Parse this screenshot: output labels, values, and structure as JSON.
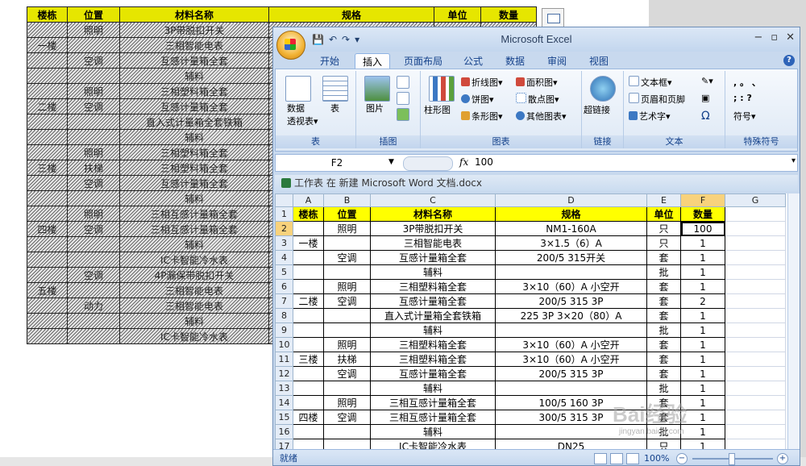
{
  "word_table": {
    "header": [
      "楼栋",
      "位置",
      "材料名称",
      "规格",
      "单位",
      "数量"
    ],
    "rows": [
      [
        "",
        "照明",
        "3P带脱扣开关",
        "",
        "",
        ""
      ],
      [
        "一楼",
        "",
        "三相智能电表",
        "",
        "",
        ""
      ],
      [
        "",
        "空调",
        "互感计量箱全套",
        "",
        "",
        ""
      ],
      [
        "",
        "",
        "辅料",
        "",
        "",
        ""
      ],
      [
        "",
        "照明",
        "三相塑料箱全套",
        "",
        "",
        ""
      ],
      [
        "二楼",
        "空调",
        "互感计量箱全套",
        "",
        "",
        ""
      ],
      [
        "",
        "",
        "直入式计量箱全套铁箱",
        "",
        "",
        ""
      ],
      [
        "",
        "",
        "辅料",
        "",
        "",
        ""
      ],
      [
        "",
        "照明",
        "三相塑料箱全套",
        "",
        "",
        ""
      ],
      [
        "三楼",
        "扶梯",
        "三相塑料箱全套",
        "",
        "",
        ""
      ],
      [
        "",
        "空调",
        "互感计量箱全套",
        "",
        "",
        ""
      ],
      [
        "",
        "",
        "辅料",
        "",
        "",
        ""
      ],
      [
        "",
        "照明",
        "三相互感计量箱全套",
        "",
        "",
        ""
      ],
      [
        "四楼",
        "空调",
        "三相互感计量箱全套",
        "",
        "",
        ""
      ],
      [
        "",
        "",
        "辅料",
        "",
        "",
        ""
      ],
      [
        "",
        "",
        "IC卡智能冷水表",
        "",
        "",
        ""
      ],
      [
        "",
        "空调",
        "4P漏保带脱扣开关",
        "",
        "",
        ""
      ],
      [
        "五楼",
        "",
        "三相智能电表",
        "",
        "",
        ""
      ],
      [
        "",
        "动力",
        "三相智能电表",
        "",
        "",
        ""
      ],
      [
        "",
        "",
        "辅料",
        "",
        "",
        ""
      ],
      [
        "",
        "",
        "IC卡智能冷水表",
        "",
        "",
        ""
      ]
    ]
  },
  "excel": {
    "title": "Microsoft Excel",
    "quick_access": [
      "💾",
      "↶",
      "↷",
      "▾"
    ],
    "window_controls": [
      "−",
      "▫",
      "✕"
    ],
    "tabs": [
      "开始",
      "插入",
      "页面布局",
      "公式",
      "数据",
      "审阅",
      "视图"
    ],
    "active_tab": "插入",
    "help": "?",
    "ribbon": {
      "groups": [
        {
          "label": "表",
          "items": [
            "数据\n透视表▾",
            "表"
          ]
        },
        {
          "label": "插图",
          "items": [
            "图片"
          ]
        },
        {
          "label": "图表",
          "items": [
            "柱形图",
            "折线图▾",
            "饼图▾",
            "条形图▾",
            "面积图▾",
            "散点图▾",
            "其他图表▾"
          ]
        },
        {
          "label": "链接",
          "items": [
            "超链接"
          ]
        },
        {
          "label": "文本",
          "items": [
            "文本框▾",
            "页眉和页脚",
            "艺术字▾",
            "Ω"
          ]
        },
        {
          "label": "特殊符号",
          "items": [
            ",  。 、",
            ";  :  ?",
            "符号▾"
          ]
        }
      ]
    },
    "formula_bar": {
      "name_box": "F2",
      "fx": "fx",
      "value": "100"
    },
    "book_title": "工作表 在 新建 Microsoft Word 文档.docx",
    "columns": [
      "A",
      "B",
      "C",
      "D",
      "E",
      "F",
      "G"
    ],
    "header_row": [
      "楼栋",
      "位置",
      "材料名称",
      "规格",
      "单位",
      "数量"
    ],
    "rows": [
      {
        "n": "2",
        "a": "",
        "b": "照明",
        "c": "3P带脱扣开关",
        "d": "NM1-160A",
        "e": "只",
        "f": "100"
      },
      {
        "n": "3",
        "a": "一楼",
        "b": "",
        "c": "三相智能电表",
        "d": "3×1.5（6）A",
        "e": "只",
        "f": "1"
      },
      {
        "n": "4",
        "a": "",
        "b": "空调",
        "c": "互感计量箱全套",
        "d": "200/5 315开关",
        "e": "套",
        "f": "1"
      },
      {
        "n": "5",
        "a": "",
        "b": "",
        "c": "辅料",
        "d": "",
        "e": "批",
        "f": "1"
      },
      {
        "n": "6",
        "a": "",
        "b": "照明",
        "c": "三相塑料箱全套",
        "d": "3×10（60）A 小空开",
        "e": "套",
        "f": "1"
      },
      {
        "n": "7",
        "a": "二楼",
        "b": "空调",
        "c": "互感计量箱全套",
        "d": "200/5 315 3P",
        "e": "套",
        "f": "2"
      },
      {
        "n": "8",
        "a": "",
        "b": "",
        "c": "直入式计量箱全套铁箱",
        "d": "225 3P 3×20（80）A",
        "e": "套",
        "f": "1"
      },
      {
        "n": "9",
        "a": "",
        "b": "",
        "c": "辅料",
        "d": "",
        "e": "批",
        "f": "1"
      },
      {
        "n": "10",
        "a": "",
        "b": "照明",
        "c": "三相塑料箱全套",
        "d": "3×10（60）A 小空开",
        "e": "套",
        "f": "1"
      },
      {
        "n": "11",
        "a": "三楼",
        "b": "扶梯",
        "c": "三相塑料箱全套",
        "d": "3×10（60）A 小空开",
        "e": "套",
        "f": "1"
      },
      {
        "n": "12",
        "a": "",
        "b": "空调",
        "c": "互感计量箱全套",
        "d": "200/5 315 3P",
        "e": "套",
        "f": "1"
      },
      {
        "n": "13",
        "a": "",
        "b": "",
        "c": "辅料",
        "d": "",
        "e": "批",
        "f": "1"
      },
      {
        "n": "14",
        "a": "",
        "b": "照明",
        "c": "三相互感计量箱全套",
        "d": "100/5 160 3P",
        "e": "套",
        "f": "1"
      },
      {
        "n": "15",
        "a": "四楼",
        "b": "空调",
        "c": "三相互感计量箱全套",
        "d": "300/5 315 3P",
        "e": "套",
        "f": "1"
      },
      {
        "n": "16",
        "a": "",
        "b": "",
        "c": "辅料",
        "d": "",
        "e": "批",
        "f": "1"
      },
      {
        "n": "17",
        "a": "",
        "b": "",
        "c": "IC卡智能冷水表",
        "d": "DN25",
        "e": "只",
        "f": "1"
      }
    ],
    "status": {
      "ready": "就绪",
      "zoom": "100%",
      "minus": "−",
      "plus": "+"
    }
  },
  "watermark": {
    "text": "Bai经验",
    "sub": "jingyan.baidu.com"
  }
}
